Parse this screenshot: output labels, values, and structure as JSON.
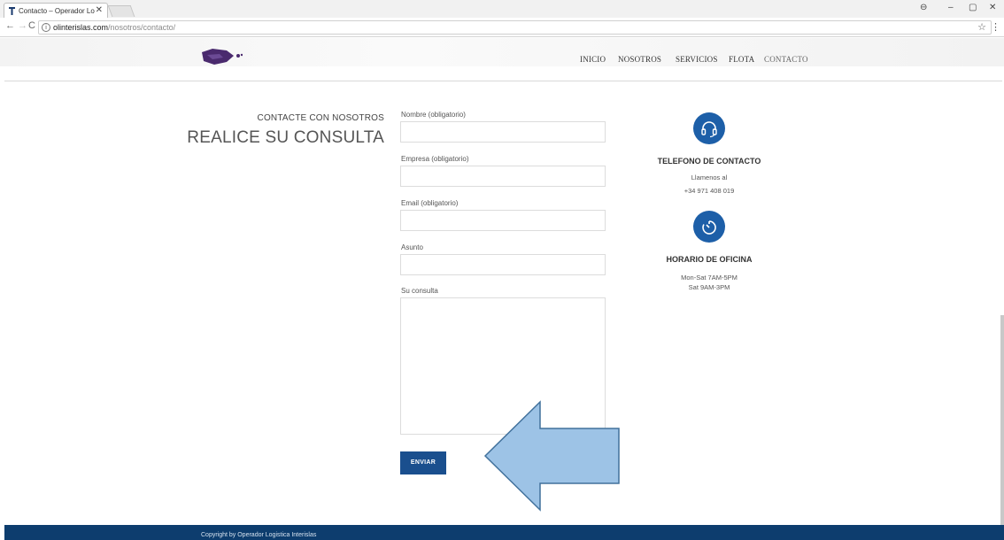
{
  "browser": {
    "tab_title": "Contacto – Operador Lo",
    "url_host": "olinterislas.com",
    "url_path": "/nosotros/contacto/"
  },
  "nav": {
    "items": [
      "INICIO",
      "NOSOTROS",
      "SERVICIOS",
      "FLOTA",
      "CONTACTO"
    ]
  },
  "contact": {
    "eyebrow": "CONTACTE CON NOSOTROS",
    "title": "REALICE SU CONSULTA"
  },
  "form": {
    "fields": [
      {
        "label": "Nombre (obligatorio)",
        "value": ""
      },
      {
        "label": "Empresa (obligatorio)",
        "value": ""
      },
      {
        "label": "Email (obligatorio)",
        "value": ""
      },
      {
        "label": "Asunto",
        "value": ""
      },
      {
        "label": "Su consulta",
        "value": ""
      }
    ],
    "submit_label": "ENVIAR"
  },
  "info": {
    "phone": {
      "title": "TELEFONO DE CONTACTO",
      "line1": "Llamenos al",
      "line2": "+34 971 408 019",
      "icon": "headset-icon"
    },
    "hours": {
      "title": "HORARIO DE OFICINA",
      "line1": "Mon-Sat 7AM-5PM",
      "line2": "Sat 9AM-3PM",
      "icon": "timer-icon"
    }
  },
  "footer": {
    "copyright": "Copyright by Operador Logistica Interislas"
  },
  "colors": {
    "brand_blue": "#1d5fa8",
    "button_blue": "#1a4f8e",
    "footer_blue": "#0d3d6e",
    "arrow_fill": "#9dc3e6",
    "arrow_stroke": "#41719c"
  }
}
